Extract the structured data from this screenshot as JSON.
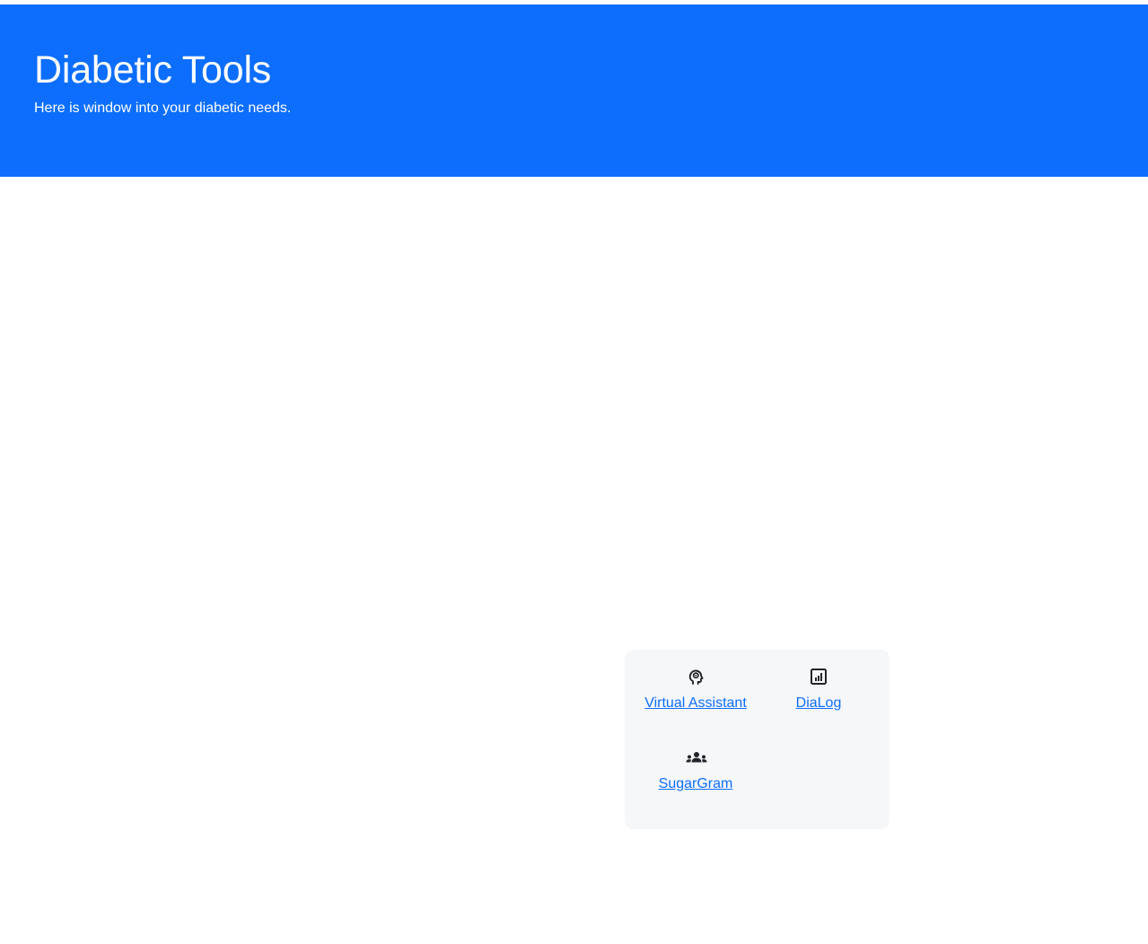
{
  "header": {
    "title": "Diabetic Tools",
    "subtitle": "Here is window into your diabetic needs."
  },
  "tools": [
    {
      "label": "Virtual Assistant",
      "icon": "head-brain-icon"
    },
    {
      "label": "DiaLog",
      "icon": "bar-chart-square-icon"
    },
    {
      "label": "SugarGram",
      "icon": "people-group-icon"
    }
  ],
  "colors": {
    "primary": "#0d6efd",
    "panel_background": "#f6f7f9",
    "icon": "#212529"
  }
}
